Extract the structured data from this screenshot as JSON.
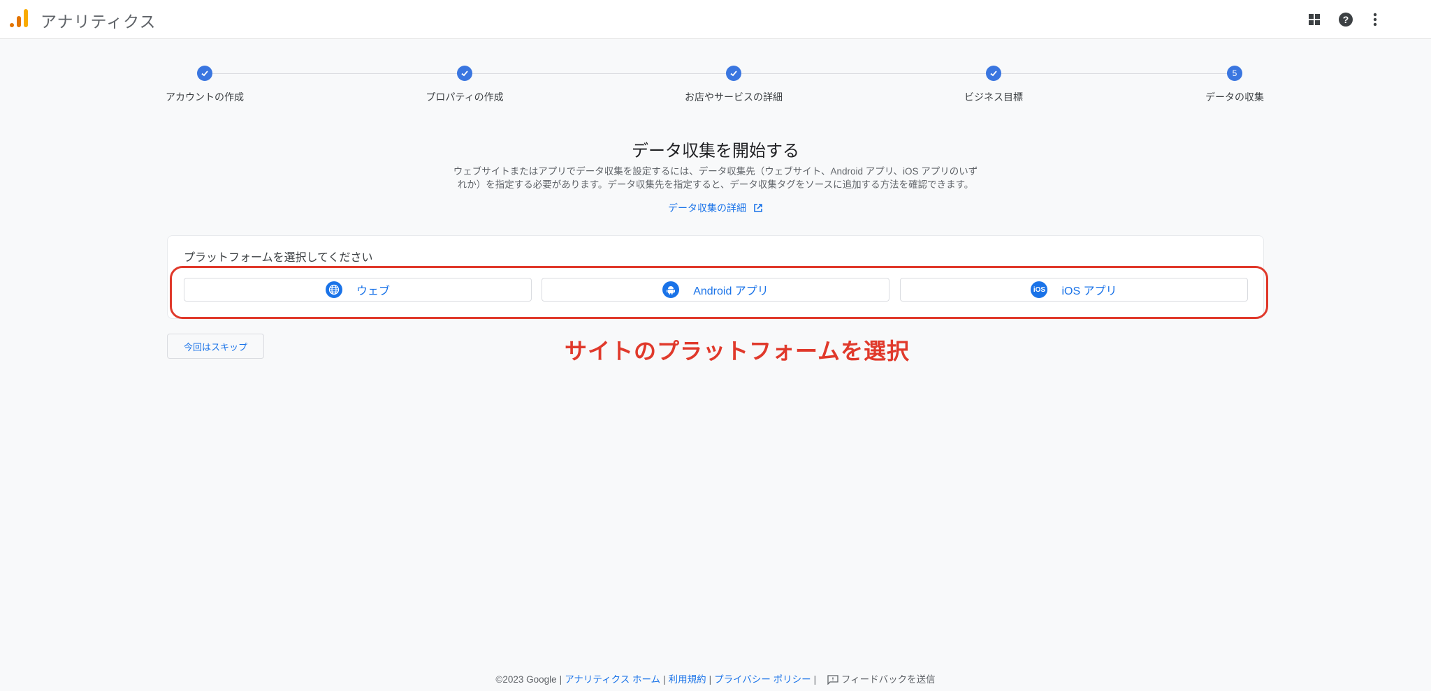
{
  "app": {
    "title": "アナリティクス",
    "brand_colors": [
      "#f9ab00",
      "#e37400"
    ]
  },
  "header": {
    "icons": [
      "apps-grid-icon",
      "help-icon",
      "more-vert-icon"
    ]
  },
  "steps": [
    {
      "label": "アカウントの作成",
      "state": "done"
    },
    {
      "label": "プロパティの作成",
      "state": "done"
    },
    {
      "label": "お店やサービスの詳細",
      "state": "done"
    },
    {
      "label": "ビジネス目標",
      "state": "done"
    },
    {
      "label": "データの収集",
      "state": "current",
      "number": "5"
    }
  ],
  "main": {
    "heading": "データ収集を開始する",
    "description_line1": "ウェブサイトまたはアプリでデータ収集を設定するには、データ収集先（ウェブサイト、Android アプリ、iOS アプリのいず",
    "description_line2": "れか）を指定する必要があります。データ収集先を指定すると、データ収集タグをソースに追加する方法を確認できます。",
    "detail_link": "データ収集の詳細",
    "platform_prompt": "プラットフォームを選択してください",
    "platforms": [
      {
        "label": "ウェブ",
        "icon": "globe-icon"
      },
      {
        "label": "Android アプリ",
        "icon": "android-icon"
      },
      {
        "label": "iOS アプリ",
        "icon": "ios-icon",
        "icon_text": "iOS"
      }
    ],
    "skip_button": "今回はスキップ",
    "annotation": "サイトのプラットフォームを選択"
  },
  "footer": {
    "copyright": "©2023 Google",
    "links": [
      "アナリティクス ホーム",
      "利用規約",
      "プライバシー ポリシー"
    ],
    "feedback": "フィードバックを送信"
  },
  "colors": {
    "accent": "#1a73e8",
    "step": "#3a76e0",
    "annotation": "#e0392b"
  }
}
